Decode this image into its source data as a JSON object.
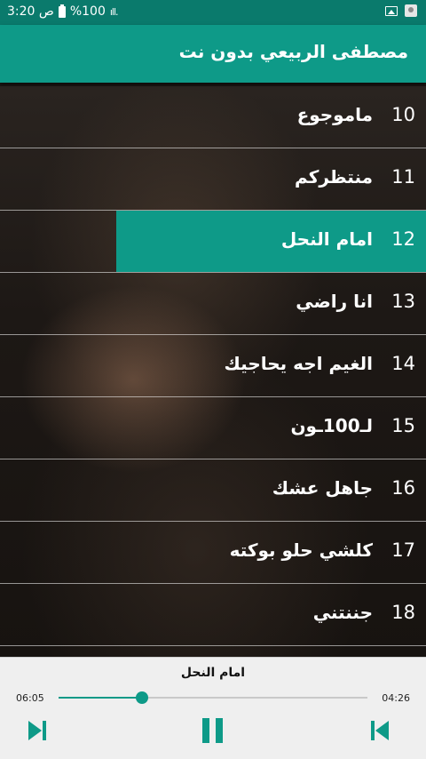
{
  "status": {
    "time": "3:20 ص",
    "battery": "%100",
    "signal": "ıll."
  },
  "app": {
    "title": "مصطفى الربيعي بدون نت"
  },
  "songs": [
    {
      "num": "10",
      "title": "ماموجوع",
      "active": false
    },
    {
      "num": "11",
      "title": "منتظركم",
      "active": false
    },
    {
      "num": "12",
      "title": "امام النحل",
      "active": true
    },
    {
      "num": "13",
      "title": "انا راضي",
      "active": false
    },
    {
      "num": "14",
      "title": "الغيم اجه يحاجيك",
      "active": false
    },
    {
      "num": "15",
      "title": "لـ100ـون",
      "active": false
    },
    {
      "num": "16",
      "title": "جاهل عشك",
      "active": false
    },
    {
      "num": "17",
      "title": "كلشي حلو بوكته",
      "active": false
    },
    {
      "num": "18",
      "title": "جننتني",
      "active": false
    }
  ],
  "player": {
    "now_playing": "امام النحل",
    "time_left": "06:05",
    "time_right": "04:26",
    "progress": 0.27
  },
  "colors": {
    "accent": "#0e9a88",
    "status_bar": "#0a7a6c",
    "player_bg": "#efefef"
  },
  "icons": {
    "prev": "skip-previous-icon",
    "pause": "pause-icon",
    "next": "skip-next-icon"
  }
}
